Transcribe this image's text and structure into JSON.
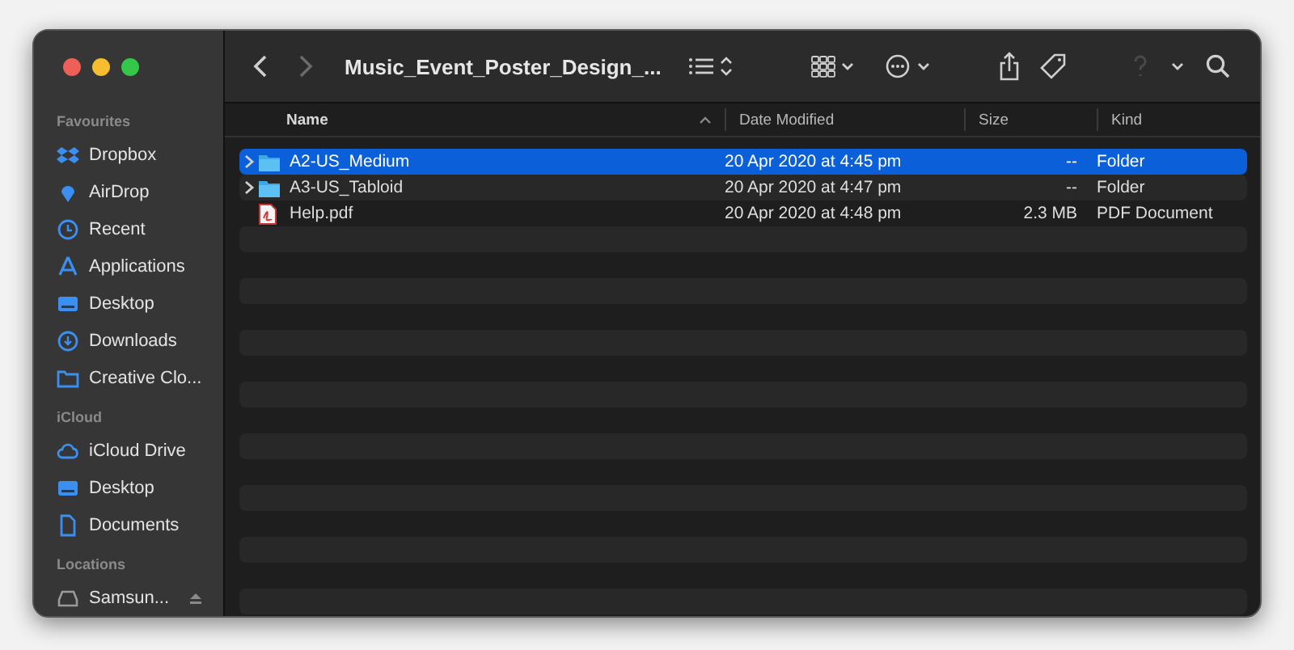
{
  "window": {
    "title": "Music_Event_Poster_Design_..."
  },
  "sidebar": {
    "sections": [
      {
        "heading": "Favourites",
        "items": [
          {
            "label": "Dropbox"
          },
          {
            "label": "AirDrop"
          },
          {
            "label": "Recent"
          },
          {
            "label": "Applications"
          },
          {
            "label": "Desktop"
          },
          {
            "label": "Downloads"
          },
          {
            "label": "Creative Clo..."
          }
        ]
      },
      {
        "heading": "iCloud",
        "items": [
          {
            "label": "iCloud Drive"
          },
          {
            "label": "Desktop"
          },
          {
            "label": "Documents"
          }
        ]
      },
      {
        "heading": "Locations",
        "items": [
          {
            "label": "Samsun...",
            "ejectable": true
          }
        ]
      }
    ]
  },
  "table": {
    "columns": [
      "Name",
      "Date Modified",
      "Size",
      "Kind"
    ],
    "rows": [
      {
        "name": "A2-US_Medium",
        "kind": "folder",
        "date": "20 Apr 2020 at 4:45 pm",
        "size": "--",
        "type": "Folder",
        "selected": true
      },
      {
        "name": "A3-US_Tabloid",
        "kind": "folder",
        "date": "20 Apr 2020 at 4:47 pm",
        "size": "--",
        "type": "Folder",
        "selected": false
      },
      {
        "name": "Help.pdf",
        "kind": "pdf",
        "date": "20 Apr 2020 at 4:48 pm",
        "size": "2.3 MB",
        "type": "PDF Document",
        "selected": false
      }
    ]
  }
}
